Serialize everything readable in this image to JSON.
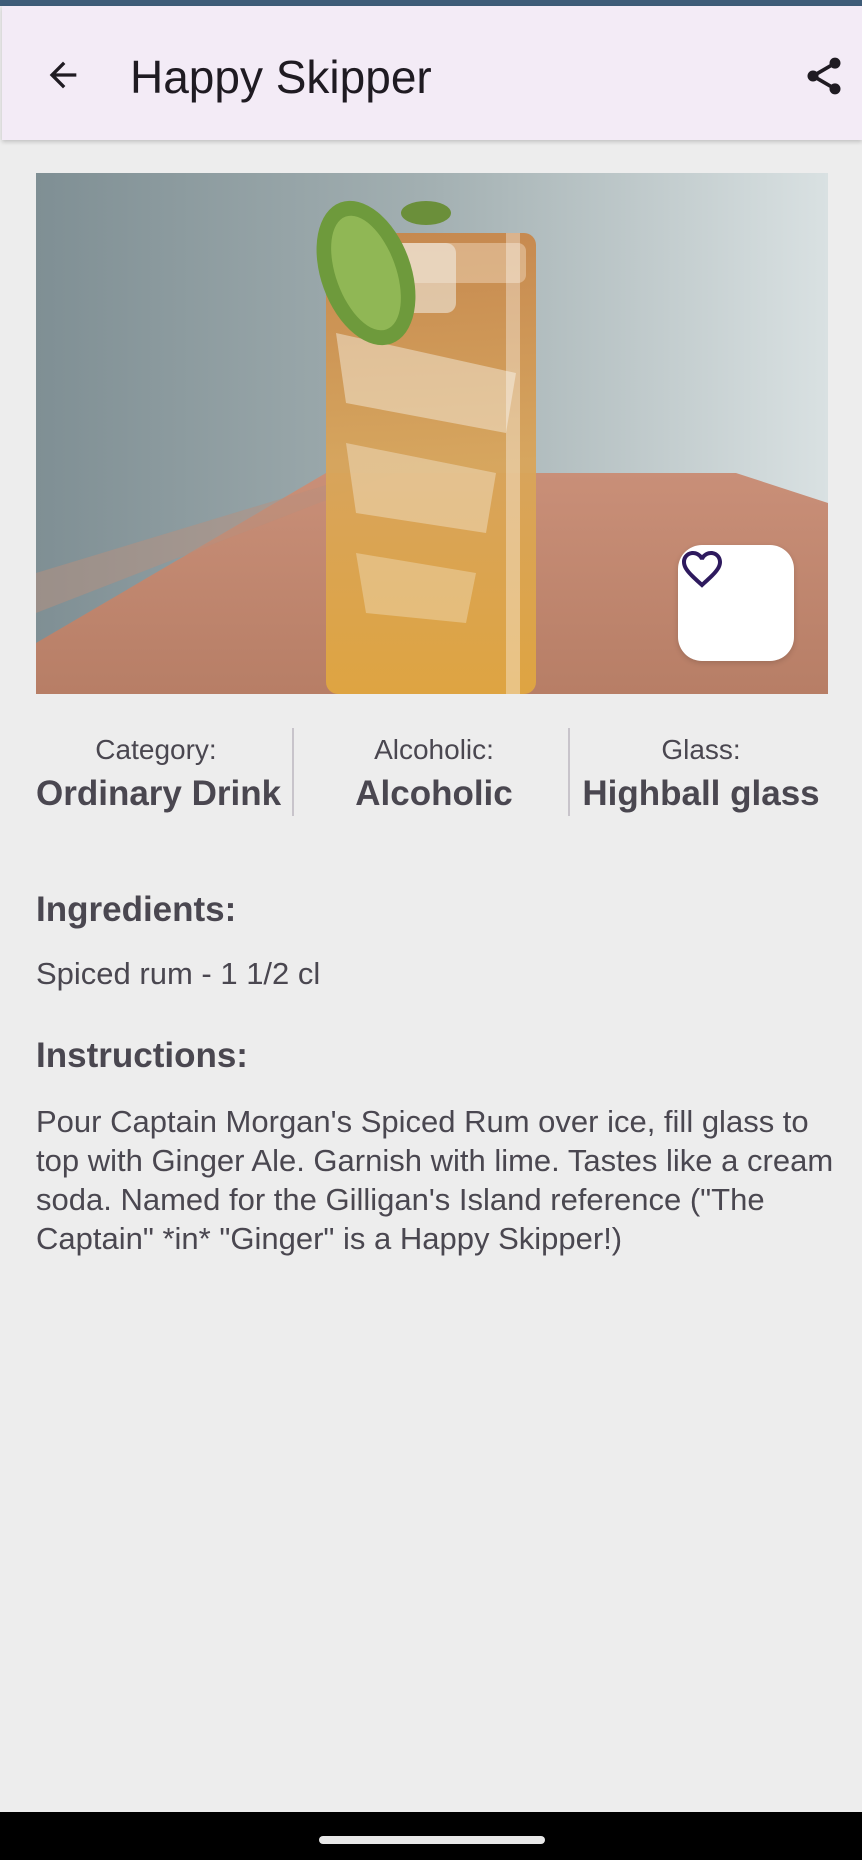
{
  "app_bar": {
    "title": "Happy Skipper",
    "back_icon": "arrow-back-icon",
    "share_icon": "share-icon",
    "background": "#f3ebf6"
  },
  "hero": {
    "favorite_icon": "heart-outline-icon",
    "favorite_color": "#2e1a5e"
  },
  "info": {
    "category_label": "Category:",
    "category_value": "Ordinary Drink",
    "alcoholic_label": "Alcoholic:",
    "alcoholic_value": "Alcoholic",
    "glass_label": "Glass:",
    "glass_value": "Highball glass"
  },
  "ingredients": {
    "title": "Ingredients:",
    "items": [
      "Spiced rum - 1 1/2 cl"
    ]
  },
  "instructions": {
    "title": "Instructions:",
    "text": "Pour Captain Morgan's Spiced Rum over ice, fill glass to top with Ginger Ale. Garnish with lime. Tastes like a cream soda. Named for the Gilligan's Island reference (\"The Captain\" *in* \"Ginger\" is a Happy Skipper!)"
  }
}
